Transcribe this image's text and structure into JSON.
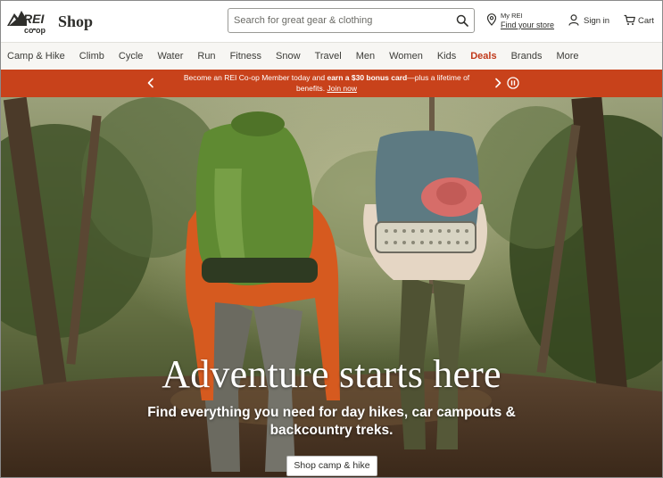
{
  "header": {
    "logo_text": "REI co-op",
    "shop_label": "Shop",
    "search": {
      "placeholder": "Search for great gear & clothing",
      "value": ""
    },
    "store": {
      "line1": "My REI",
      "line2": "Find your store"
    },
    "signin_label": "Sign in",
    "cart_label": "Cart"
  },
  "nav": {
    "items": [
      {
        "label": "Camp & Hike"
      },
      {
        "label": "Climb"
      },
      {
        "label": "Cycle"
      },
      {
        "label": "Water"
      },
      {
        "label": "Run"
      },
      {
        "label": "Fitness"
      },
      {
        "label": "Snow"
      },
      {
        "label": "Travel"
      },
      {
        "label": "Men"
      },
      {
        "label": "Women"
      },
      {
        "label": "Kids"
      },
      {
        "label": "Deals"
      },
      {
        "label": "Brands"
      },
      {
        "label": "More"
      }
    ]
  },
  "promo": {
    "text_before": "Become an REI Co-op Member today and ",
    "text_bold": "earn a $30 bonus card",
    "text_after": "—plus a lifetime of benefits. ",
    "link": "Join now"
  },
  "hero": {
    "headline": "Adventure starts here",
    "subhead": "Find everything you need for day hikes, car campouts & backcountry treks.",
    "cta_label": "Shop camp & hike"
  },
  "colors": {
    "promo_bg": "#c8421b",
    "deals_text": "#c1391a",
    "nav_bg": "#f7f6f3"
  },
  "icons": {
    "search": "search-icon",
    "store": "location-pin-icon",
    "signin": "user-icon",
    "cart": "cart-icon",
    "prev": "chevron-left-icon",
    "next": "chevron-right-icon",
    "pause": "pause-icon"
  }
}
